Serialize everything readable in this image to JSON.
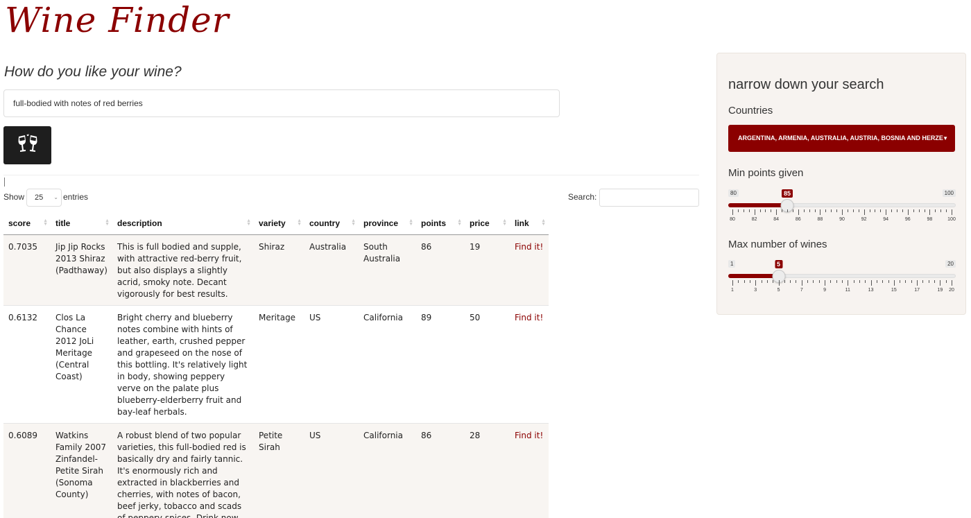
{
  "header": {
    "title": "Wine Finder"
  },
  "query": {
    "prompt": "How do you like your wine?",
    "value": "full-bodied with notes of red berries",
    "button_icon": "clinking-glasses-icon"
  },
  "table_controls": {
    "show_label": "Show",
    "length_value": "25",
    "entries_label": "entries",
    "search_label": "Search:"
  },
  "table": {
    "columns": [
      "score",
      "title",
      "description",
      "variety",
      "country",
      "province",
      "points",
      "price",
      "link"
    ],
    "rows": [
      {
        "score": "0.7035",
        "title": "Jip Jip Rocks 2013 Shiraz (Padthaway)",
        "description": "This is full bodied and supple, with attractive red-berry fruit, but also displays a slightly acrid, smoky note. Decant vigorously for best results.",
        "variety": "Shiraz",
        "country": "Australia",
        "province": "South Australia",
        "points": "86",
        "price": "19",
        "link": "Find it!"
      },
      {
        "score": "0.6132",
        "title": "Clos La Chance 2012 JoLi Meritage (Central Coast)",
        "description": "Bright cherry and blueberry notes combine with hints of leather, earth, crushed pepper and grapeseed on the nose of this bottling. It's relatively light in body, showing peppery verve on the palate plus blueberry-elderberry fruit and bay-leaf herbals.",
        "variety": "Meritage",
        "country": "US",
        "province": "California",
        "points": "89",
        "price": "50",
        "link": "Find it!"
      },
      {
        "score": "0.6089",
        "title": "Watkins Family 2007 Zinfandel-Petite Sirah (Sonoma County)",
        "description": "A robust blend of two popular varieties, this full-bodied red is basically dry and fairly tannic. It's enormously rich and extracted in blackberries and cherries, with notes of bacon, beef jerky, tobacco and scads of peppery spices. Drink now.",
        "variety": "Petite Sirah",
        "country": "US",
        "province": "California",
        "points": "86",
        "price": "28",
        "link": "Find it!"
      }
    ]
  },
  "sidebar": {
    "title": "narrow down your search",
    "countries_label": "Countries",
    "countries_value": "ARGENTINA, ARMENIA, AUSTRALIA, AUSTRIA, BOSNIA AND HERZE",
    "min_points": {
      "label": "Min points given",
      "min": 80,
      "max": 100,
      "value": 85,
      "min_text": "80",
      "max_text": "100",
      "value_text": "85",
      "tick_labels": [
        "80",
        "82",
        "84",
        "86",
        "88",
        "90",
        "92",
        "94",
        "96",
        "98",
        "100"
      ]
    },
    "max_wines": {
      "label": "Max number of wines",
      "min": 1,
      "max": 20,
      "value": 5,
      "min_text": "1",
      "max_text": "20",
      "value_text": "5",
      "tick_labels": [
        "1",
        "3",
        "5",
        "7",
        "9",
        "11",
        "13",
        "15",
        "17",
        "19",
        "20"
      ]
    }
  },
  "colors": {
    "accent": "#8b0000",
    "panel_bg": "#f7f3f0",
    "row_odd": "#f8f5f2"
  }
}
